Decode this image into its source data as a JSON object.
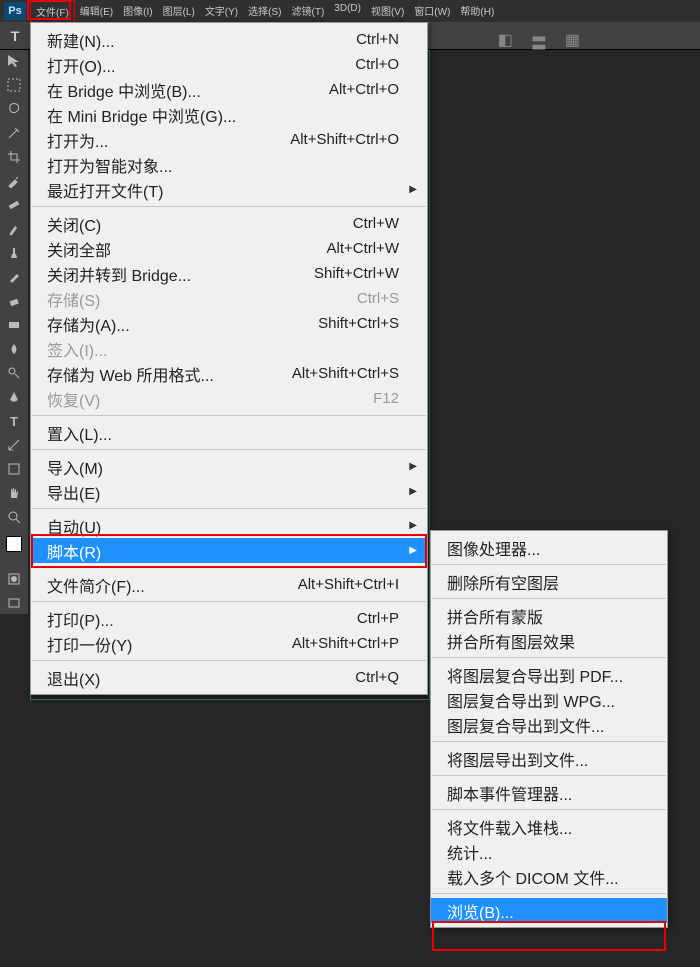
{
  "app_logo": "Ps",
  "menubar": [
    "文件(F)",
    "编辑(E)",
    "图像(I)",
    "图层(L)",
    "文字(Y)",
    "选择(S)",
    "滤镜(T)",
    "3D(D)",
    "视图(V)",
    "窗口(W)",
    "帮助(H)"
  ],
  "option_tool": "T",
  "panel_icons": [
    "◧",
    "〓",
    "▦"
  ],
  "file_menu": [
    {
      "label": "新建(N)...",
      "shortcut": "Ctrl+N"
    },
    {
      "label": "打开(O)...",
      "shortcut": "Ctrl+O"
    },
    {
      "label": "在 Bridge 中浏览(B)...",
      "shortcut": "Alt+Ctrl+O"
    },
    {
      "label": "在 Mini Bridge 中浏览(G)..."
    },
    {
      "label": "打开为...",
      "shortcut": "Alt+Shift+Ctrl+O"
    },
    {
      "label": "打开为智能对象..."
    },
    {
      "label": "最近打开文件(T)",
      "submenu": true
    },
    {
      "sep": true
    },
    {
      "label": "关闭(C)",
      "shortcut": "Ctrl+W"
    },
    {
      "label": "关闭全部",
      "shortcut": "Alt+Ctrl+W"
    },
    {
      "label": "关闭并转到 Bridge...",
      "shortcut": "Shift+Ctrl+W"
    },
    {
      "label": "存储(S)",
      "shortcut": "Ctrl+S",
      "disabled": true
    },
    {
      "label": "存储为(A)...",
      "shortcut": "Shift+Ctrl+S"
    },
    {
      "label": "签入(I)...",
      "disabled": true
    },
    {
      "label": "存储为 Web 所用格式...",
      "shortcut": "Alt+Shift+Ctrl+S"
    },
    {
      "label": "恢复(V)",
      "shortcut": "F12",
      "disabled": true
    },
    {
      "sep": true
    },
    {
      "label": "置入(L)..."
    },
    {
      "sep": true
    },
    {
      "label": "导入(M)",
      "submenu": true
    },
    {
      "label": "导出(E)",
      "submenu": true
    },
    {
      "sep": true
    },
    {
      "label": "自动(U)",
      "submenu": true
    },
    {
      "label": "脚本(R)",
      "submenu": true,
      "highlight": true
    },
    {
      "sep": true
    },
    {
      "label": "文件简介(F)...",
      "shortcut": "Alt+Shift+Ctrl+I"
    },
    {
      "sep": true
    },
    {
      "label": "打印(P)...",
      "shortcut": "Ctrl+P"
    },
    {
      "label": "打印一份(Y)",
      "shortcut": "Alt+Shift+Ctrl+P"
    },
    {
      "sep": true
    },
    {
      "label": "退出(X)",
      "shortcut": "Ctrl+Q"
    }
  ],
  "script_menu": [
    {
      "label": "图像处理器..."
    },
    {
      "sep": true
    },
    {
      "label": "删除所有空图层"
    },
    {
      "sep": true
    },
    {
      "label": "拼合所有蒙版"
    },
    {
      "label": "拼合所有图层效果"
    },
    {
      "sep": true
    },
    {
      "label": "将图层复合导出到 PDF..."
    },
    {
      "label": "图层复合导出到 WPG..."
    },
    {
      "label": "图层复合导出到文件..."
    },
    {
      "sep": true
    },
    {
      "label": "将图层导出到文件..."
    },
    {
      "sep": true
    },
    {
      "label": "脚本事件管理器..."
    },
    {
      "sep": true
    },
    {
      "label": "将文件载入堆栈..."
    },
    {
      "label": "统计..."
    },
    {
      "label": "载入多个 DICOM 文件..."
    },
    {
      "sep": true
    },
    {
      "label": "浏览(B)...",
      "highlight": true
    }
  ]
}
